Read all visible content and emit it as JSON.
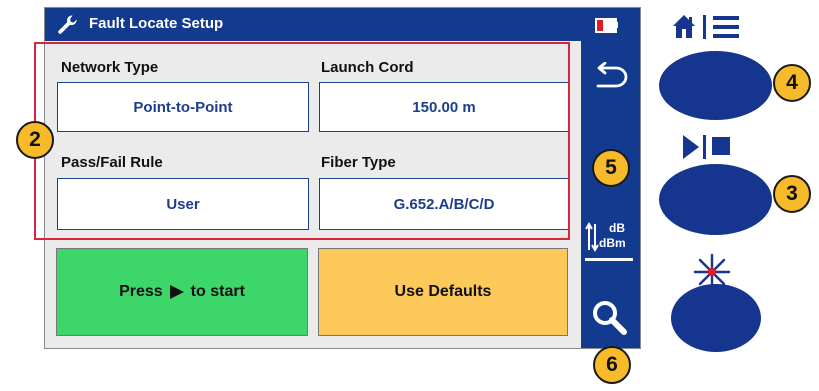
{
  "title_bar": {
    "title": "Fault Locate Setup"
  },
  "settings": {
    "network_type": {
      "label": "Network Type",
      "value": "Point-to-Point"
    },
    "launch_cord": {
      "label": "Launch Cord",
      "value": "150.00 m"
    },
    "pass_fail_rule": {
      "label": "Pass/Fail Rule",
      "value": "User"
    },
    "fiber_type": {
      "label": "Fiber Type",
      "value": "G.652.A/B/C/D"
    }
  },
  "actions": {
    "start_prefix": "Press",
    "start_suffix": "to start",
    "use_defaults": "Use Defaults"
  },
  "sidebar": {
    "dbm_top": "dB",
    "dbm_bottom": "dBm"
  },
  "callouts": {
    "c2": "2",
    "c3": "3",
    "c4": "4",
    "c5": "5",
    "c6": "6"
  },
  "colors": {
    "title_bar": "#123a8f",
    "start_button": "#3cd66a",
    "defaults_button": "#fcc95a",
    "highlight": "#d8263a",
    "callout": "#f6ba2a",
    "hardware_button": "#15358e"
  },
  "icons": {
    "title": "wrench-icon",
    "battery": "battery-low-icon",
    "back": "back-arrow-icon",
    "units": "db-dbm-toggle-icon",
    "search": "magnifier-icon",
    "home_menu": "home-menu-icon",
    "play_stop": "play-stop-icon",
    "laser": "laser-icon"
  }
}
